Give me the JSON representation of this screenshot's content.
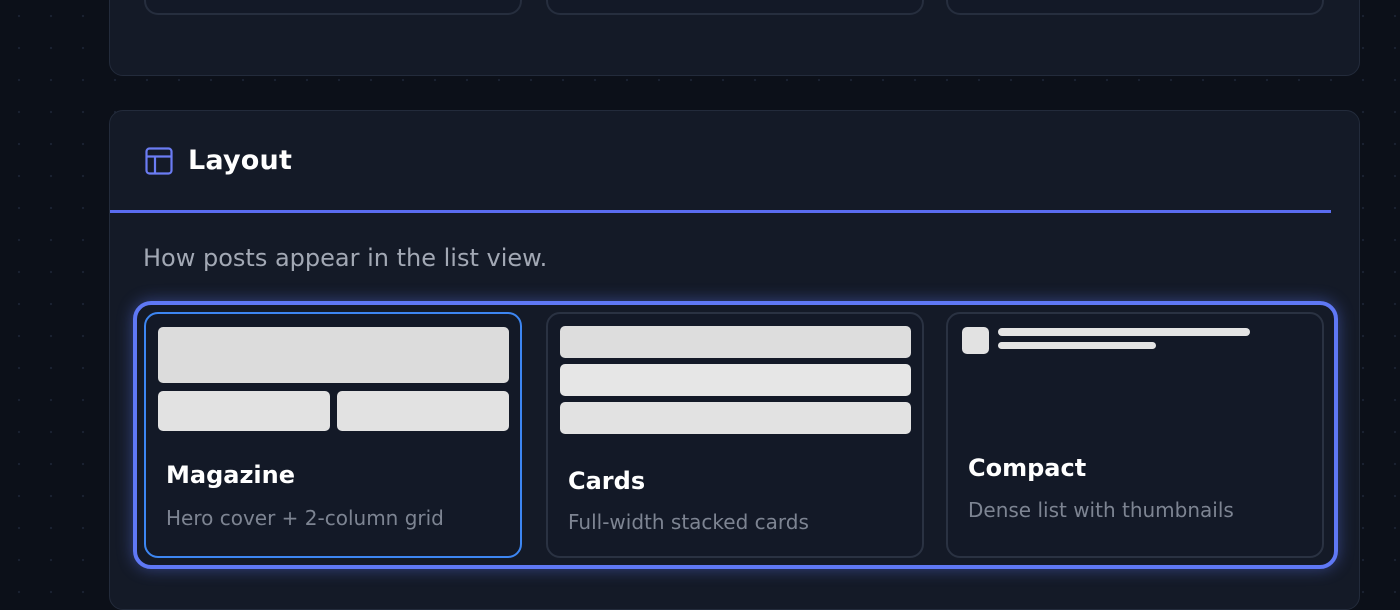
{
  "section": {
    "title": "Layout",
    "icon": "layout-icon",
    "description": "How posts appear in the list view."
  },
  "layout_options": [
    {
      "id": "magazine",
      "title": "Magazine",
      "subtitle": "Hero cover + 2-column grid",
      "selected": true
    },
    {
      "id": "cards",
      "title": "Cards",
      "subtitle": "Full-width stacked cards",
      "selected": false
    },
    {
      "id": "compact",
      "title": "Compact",
      "subtitle": "Dense list with thumbnails",
      "selected": false
    }
  ],
  "colors": {
    "accent": "#5a6cf0",
    "selected_border": "#3d86f2",
    "background": "#0c1019",
    "card": "#141a27"
  }
}
